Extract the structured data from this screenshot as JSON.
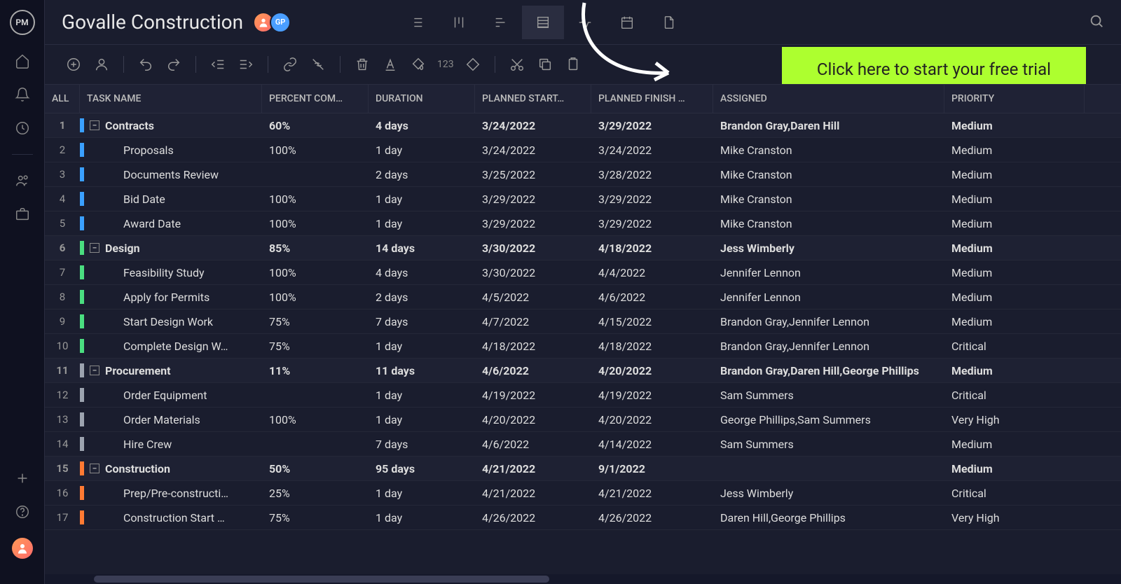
{
  "logo_text": "PM",
  "project_title": "Govalle Construction",
  "avatar2_text": "GP",
  "cta_text": "Click here to start your free trial",
  "toolbar_number": "123",
  "columns": {
    "all": "ALL",
    "task": "TASK NAME",
    "percent": "PERCENT COM…",
    "duration": "DURATION",
    "start": "PLANNED START…",
    "finish": "PLANNED FINISH …",
    "assigned": "ASSIGNED",
    "priority": "PRIORITY"
  },
  "rows": [
    {
      "num": "1",
      "parent": true,
      "color": "#3aa0ff",
      "name": "Contracts",
      "percent": "60%",
      "duration": "4 days",
      "start": "3/24/2022",
      "finish": "3/29/2022",
      "assigned": "Brandon Gray,Daren Hill",
      "priority": "Medium"
    },
    {
      "num": "2",
      "parent": false,
      "color": "#3aa0ff",
      "name": "Proposals",
      "percent": "100%",
      "duration": "1 day",
      "start": "3/24/2022",
      "finish": "3/24/2022",
      "assigned": "Mike Cranston",
      "priority": "Medium"
    },
    {
      "num": "3",
      "parent": false,
      "color": "#3aa0ff",
      "name": "Documents Review",
      "percent": "",
      "duration": "2 days",
      "start": "3/25/2022",
      "finish": "3/28/2022",
      "assigned": "Mike Cranston",
      "priority": "Medium"
    },
    {
      "num": "4",
      "parent": false,
      "color": "#3aa0ff",
      "name": "Bid Date",
      "percent": "100%",
      "duration": "1 day",
      "start": "3/29/2022",
      "finish": "3/29/2022",
      "assigned": "Mike Cranston",
      "priority": "Medium"
    },
    {
      "num": "5",
      "parent": false,
      "color": "#3aa0ff",
      "name": "Award Date",
      "percent": "100%",
      "duration": "1 day",
      "start": "3/29/2022",
      "finish": "3/29/2022",
      "assigned": "Mike Cranston",
      "priority": "Medium"
    },
    {
      "num": "6",
      "parent": true,
      "color": "#4ade80",
      "name": "Design",
      "percent": "85%",
      "duration": "14 days",
      "start": "3/30/2022",
      "finish": "4/18/2022",
      "assigned": "Jess Wimberly",
      "priority": "Medium"
    },
    {
      "num": "7",
      "parent": false,
      "color": "#4ade80",
      "name": "Feasibility Study",
      "percent": "100%",
      "duration": "4 days",
      "start": "3/30/2022",
      "finish": "4/4/2022",
      "assigned": "Jennifer Lennon",
      "priority": "Medium"
    },
    {
      "num": "8",
      "parent": false,
      "color": "#4ade80",
      "name": "Apply for Permits",
      "percent": "100%",
      "duration": "2 days",
      "start": "4/5/2022",
      "finish": "4/6/2022",
      "assigned": "Jennifer Lennon",
      "priority": "Medium"
    },
    {
      "num": "9",
      "parent": false,
      "color": "#4ade80",
      "name": "Start Design Work",
      "percent": "75%",
      "duration": "7 days",
      "start": "4/7/2022",
      "finish": "4/15/2022",
      "assigned": "Brandon Gray,Jennifer Lennon",
      "priority": "Medium"
    },
    {
      "num": "10",
      "parent": false,
      "color": "#4ade80",
      "name": "Complete Design W…",
      "percent": "75%",
      "duration": "1 day",
      "start": "4/18/2022",
      "finish": "4/18/2022",
      "assigned": "Brandon Gray,Jennifer Lennon",
      "priority": "Critical"
    },
    {
      "num": "11",
      "parent": true,
      "color": "#9ca3af",
      "name": "Procurement",
      "percent": "11%",
      "duration": "11 days",
      "start": "4/6/2022",
      "finish": "4/20/2022",
      "assigned": "Brandon Gray,Daren Hill,George Phillips",
      "priority": "Medium"
    },
    {
      "num": "12",
      "parent": false,
      "color": "#9ca3af",
      "name": "Order Equipment",
      "percent": "",
      "duration": "1 day",
      "start": "4/19/2022",
      "finish": "4/19/2022",
      "assigned": "Sam Summers",
      "priority": "Critical"
    },
    {
      "num": "13",
      "parent": false,
      "color": "#9ca3af",
      "name": "Order Materials",
      "percent": "100%",
      "duration": "1 day",
      "start": "4/20/2022",
      "finish": "4/20/2022",
      "assigned": "George Phillips,Sam Summers",
      "priority": "Very High"
    },
    {
      "num": "14",
      "parent": false,
      "color": "#9ca3af",
      "name": "Hire Crew",
      "percent": "",
      "duration": "7 days",
      "start": "4/6/2022",
      "finish": "4/14/2022",
      "assigned": "Sam Summers",
      "priority": "Medium"
    },
    {
      "num": "15",
      "parent": true,
      "color": "#ff7a33",
      "name": "Construction",
      "percent": "50%",
      "duration": "95 days",
      "start": "4/21/2022",
      "finish": "9/1/2022",
      "assigned": "",
      "priority": "Medium"
    },
    {
      "num": "16",
      "parent": false,
      "color": "#ff7a33",
      "name": "Prep/Pre-constructi…",
      "percent": "25%",
      "duration": "1 day",
      "start": "4/21/2022",
      "finish": "4/21/2022",
      "assigned": "Jess Wimberly",
      "priority": "Critical"
    },
    {
      "num": "17",
      "parent": false,
      "color": "#ff7a33",
      "name": "Construction Start …",
      "percent": "75%",
      "duration": "1 day",
      "start": "4/26/2022",
      "finish": "4/26/2022",
      "assigned": "Daren Hill,George Phillips",
      "priority": "Very High"
    }
  ]
}
